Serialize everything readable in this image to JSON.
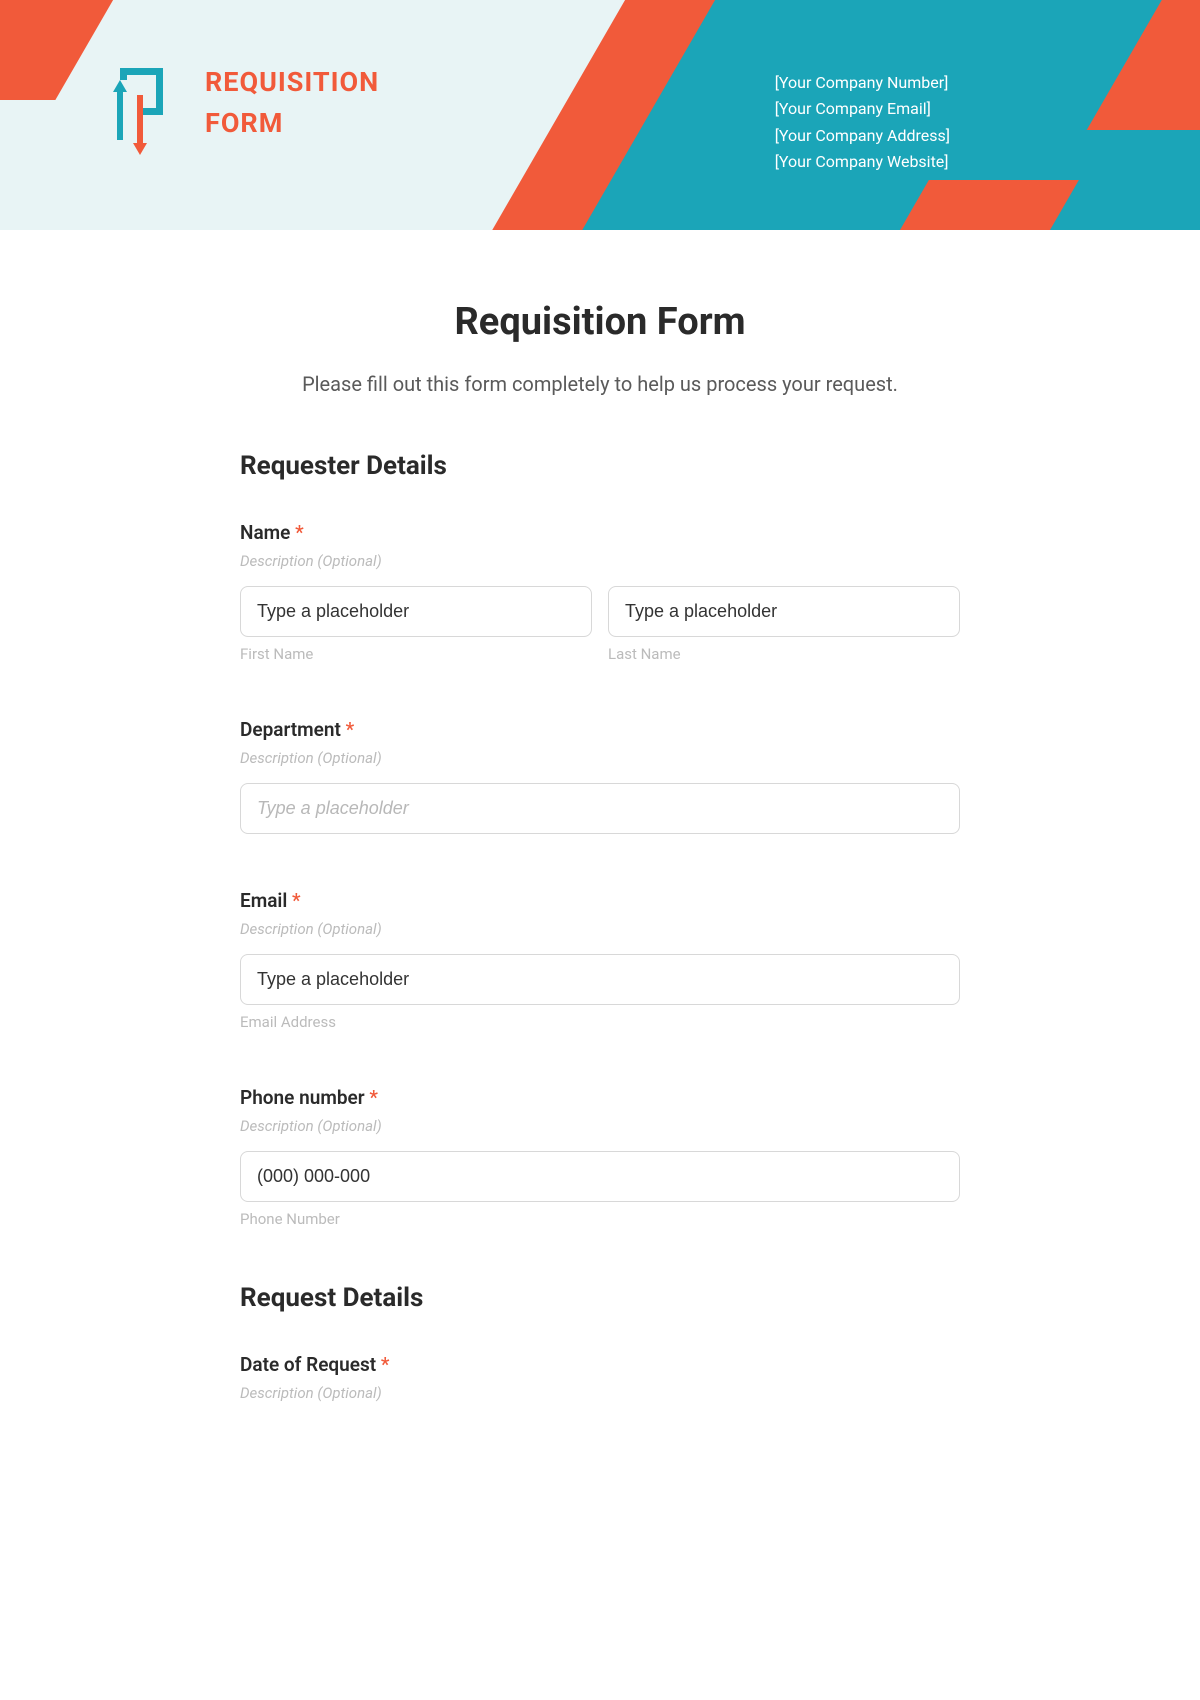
{
  "header": {
    "logo_title_line1": "REQUISITION",
    "logo_title_line2": "FORM",
    "company": {
      "number": "[Your Company Number]",
      "email": "[Your Company Email]",
      "address": "[Your Company Address]",
      "website": "[Your Company Website]"
    }
  },
  "form": {
    "title": "Requisition Form",
    "subtitle": "Please fill out this form completely to help us process your request.",
    "sections": {
      "requester": {
        "title": "Requester Details",
        "fields": {
          "name": {
            "label": "Name",
            "required": "*",
            "description": "Description (Optional)",
            "first_placeholder": "Type a placeholder",
            "first_sublabel": "First Name",
            "last_placeholder": "Type a placeholder",
            "last_sublabel": "Last Name"
          },
          "department": {
            "label": "Department",
            "required": "*",
            "description": "Description (Optional)",
            "placeholder": "Type a placeholder"
          },
          "email": {
            "label": "Email",
            "required": "*",
            "description": "Description (Optional)",
            "placeholder": "Type a placeholder",
            "sublabel": "Email Address"
          },
          "phone": {
            "label": "Phone number",
            "required": "*",
            "description": "Description (Optional)",
            "placeholder": "(000) 000-000",
            "sublabel": "Phone Number"
          }
        }
      },
      "request": {
        "title": "Request Details",
        "fields": {
          "date": {
            "label": "Date of Request",
            "required": "*",
            "description": "Description (Optional)"
          }
        }
      }
    }
  }
}
